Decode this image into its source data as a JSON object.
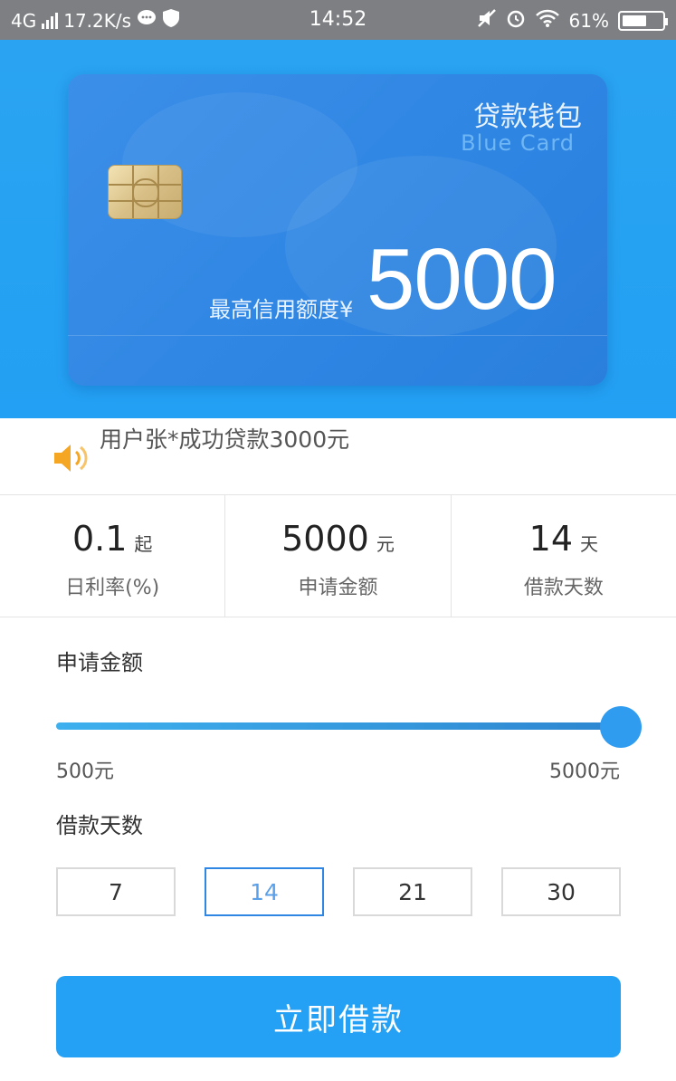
{
  "status_bar": {
    "network": "4G",
    "speed": "17.2K/s",
    "time": "14:52",
    "battery": "61%",
    "battery_level": 0.61
  },
  "card": {
    "title": "贷款钱包",
    "subtitle": "Blue Card",
    "limit_label": "最高信用额度¥",
    "limit_value": "5000"
  },
  "notice": {
    "text": "用户张*成功贷款3000元"
  },
  "stats": [
    {
      "value": "0.1",
      "unit": "起",
      "label": "日利率(%)"
    },
    {
      "value": "5000",
      "unit": "元",
      "label": "申请金额"
    },
    {
      "value": "14",
      "unit": "天",
      "label": "借款天数"
    }
  ],
  "amount": {
    "label": "申请金额",
    "min_label": "500元",
    "max_label": "5000元",
    "min": 500,
    "max": 5000,
    "value": 5000
  },
  "days": {
    "label": "借款天数",
    "options": [
      "7",
      "14",
      "21",
      "30"
    ],
    "selected": "14"
  },
  "apply_button": {
    "label": "立即借款"
  },
  "colors": {
    "primary": "#24a1f4",
    "card": "#2f86e3",
    "chip": "#d8bf86",
    "speaker": "#f5a623"
  }
}
